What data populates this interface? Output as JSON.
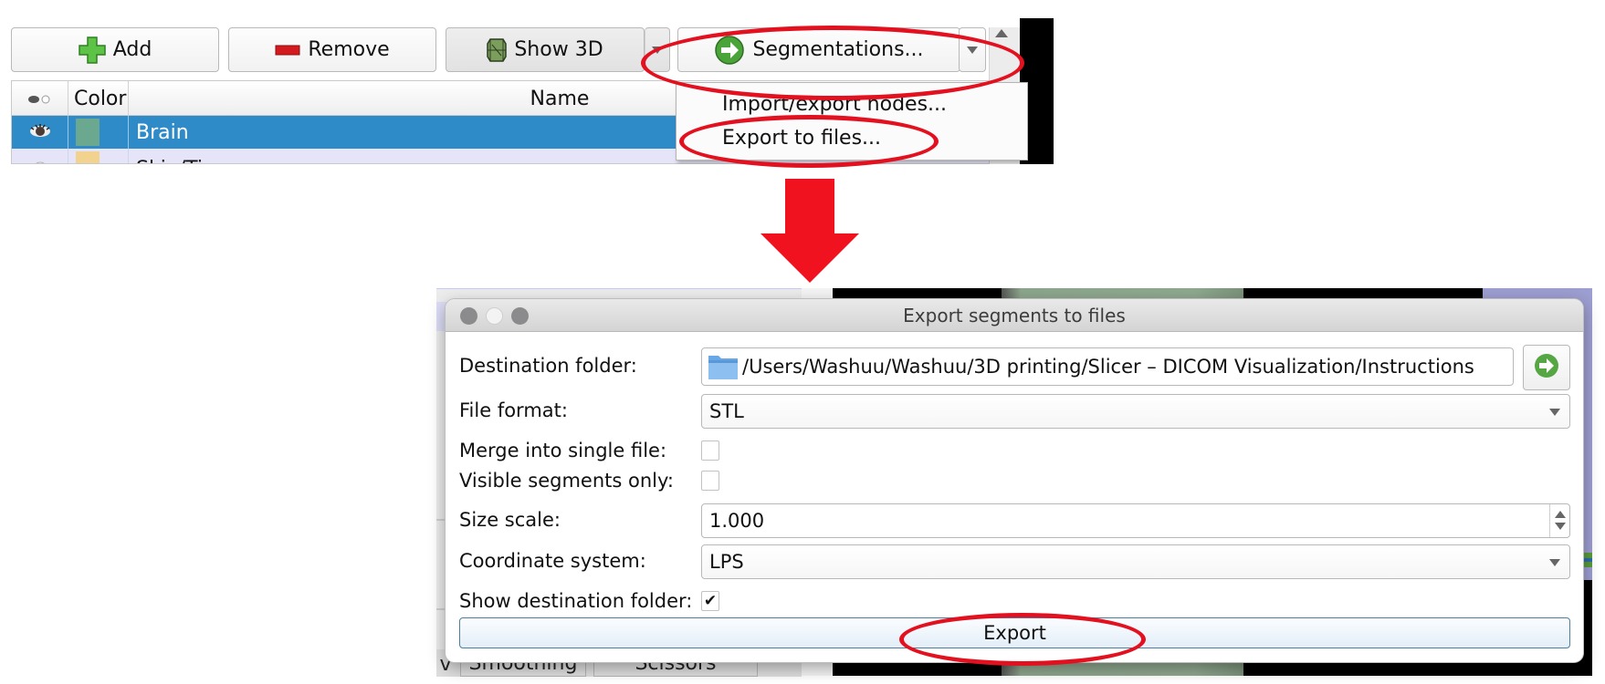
{
  "toolbar": {
    "add_label": "Add",
    "remove_label": "Remove",
    "show3d_label": "Show 3D",
    "segmentations_label": "Segmentations..."
  },
  "table": {
    "columns": {
      "visibility_icon": "eye-icon",
      "color": "Color",
      "name": "Name"
    },
    "rows": [
      {
        "name": "Brain",
        "color": "#6aa88f",
        "visible": true,
        "selected": true
      },
      {
        "name": "Skin/Tissue",
        "color": "#f2d28f",
        "visible": false,
        "selected": false
      }
    ]
  },
  "segmentations_menu": {
    "items": [
      {
        "label": "Import/export nodes..."
      },
      {
        "label": "Export to files...",
        "highlighted": true
      }
    ]
  },
  "background": {
    "tabs": [
      "v",
      "Smoothing",
      "Scissors"
    ]
  },
  "dialog": {
    "title": "Export segments to files",
    "destination_folder": {
      "label": "Destination folder:",
      "value": "/Users/Washuu/Washuu/3D printing/Slicer – DICOM Visualization/Instructions"
    },
    "file_format": {
      "label": "File format:",
      "value": "STL"
    },
    "merge_into_single_file": {
      "label": "Merge into single file:",
      "checked": false
    },
    "visible_segments_only": {
      "label": "Visible segments only:",
      "checked": false
    },
    "size_scale": {
      "label": "Size scale:",
      "value": "1.000"
    },
    "coordinate_system": {
      "label": "Coordinate system:",
      "value": "LPS"
    },
    "show_destination_folder": {
      "label": "Show destination folder:",
      "checked": true,
      "mark": "✔"
    },
    "export_label": "Export"
  },
  "annotations": {
    "color": "#e3111f",
    "highlights": [
      "Segmentations... button",
      "Export to files... menu item",
      "Export button"
    ],
    "arrow": "down"
  }
}
